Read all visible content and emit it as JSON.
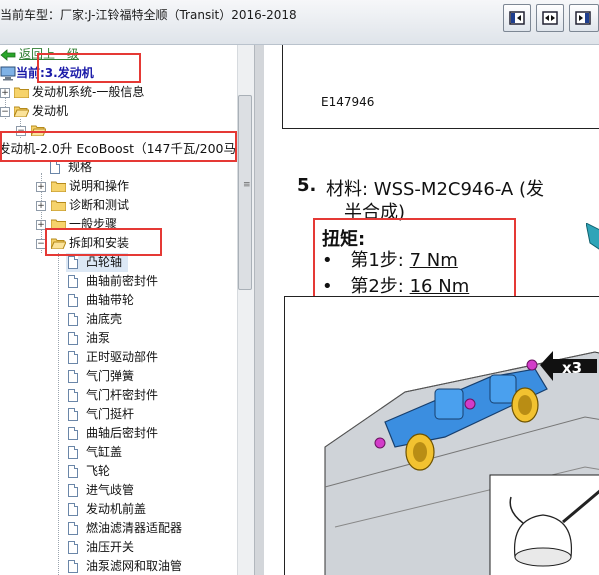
{
  "window": {
    "title": "当前车型：厂家:J-江铃福特全顺（Transit）2016-2018"
  },
  "toolbar": {
    "buttons": [
      {
        "icon": "panel-left-icon"
      },
      {
        "icon": "panel-split-icon"
      },
      {
        "icon": "panel-right-icon"
      }
    ]
  },
  "tree": {
    "back_link": "返回上一级",
    "current": "当前:3.发动机",
    "items": [
      {
        "label": "发动机系统-一般信息"
      },
      {
        "label": "发动机"
      },
      {
        "label": ""
      },
      {
        "label": "发动机-2.0升 EcoBoost（147千瓦/200马力"
      },
      {
        "label": "规格"
      },
      {
        "label": "说明和操作"
      },
      {
        "label": "诊断和测试"
      },
      {
        "label": "一般步骤"
      },
      {
        "label": "拆卸和安装"
      },
      {
        "label": "凸轮轴"
      },
      {
        "label": "曲轴前密封件"
      },
      {
        "label": "曲轴带轮"
      },
      {
        "label": "油底壳"
      },
      {
        "label": "油泵"
      },
      {
        "label": "正时驱动部件"
      },
      {
        "label": "气门弹簧"
      },
      {
        "label": "气门杆密封件"
      },
      {
        "label": "气门挺杆"
      },
      {
        "label": "曲轴后密封件"
      },
      {
        "label": "气缸盖"
      },
      {
        "label": "飞轮"
      },
      {
        "label": "进气歧管"
      },
      {
        "label": "发动机前盖"
      },
      {
        "label": "燃油滤清器适配器"
      },
      {
        "label": "油压开关"
      },
      {
        "label": "油泵滤网和取油管"
      }
    ]
  },
  "document": {
    "figure_id": "E147946",
    "step_number": "5.",
    "material_line1": "材料: WSS-M2C946-A (发",
    "material_line2": "半合成)",
    "torque_title": "扭矩:",
    "torque_steps": [
      {
        "bullet": "•",
        "label": "第1步: ",
        "value": "7 Nm"
      },
      {
        "bullet": "•",
        "label": "第2步: ",
        "value": "16 Nm"
      }
    ],
    "callout": "x3"
  },
  "colors": {
    "highlight_red": "#e53935",
    "link_green": "#2e7d32",
    "current_blue": "#1a1aa8",
    "selection_bg": "#dce8f5"
  }
}
